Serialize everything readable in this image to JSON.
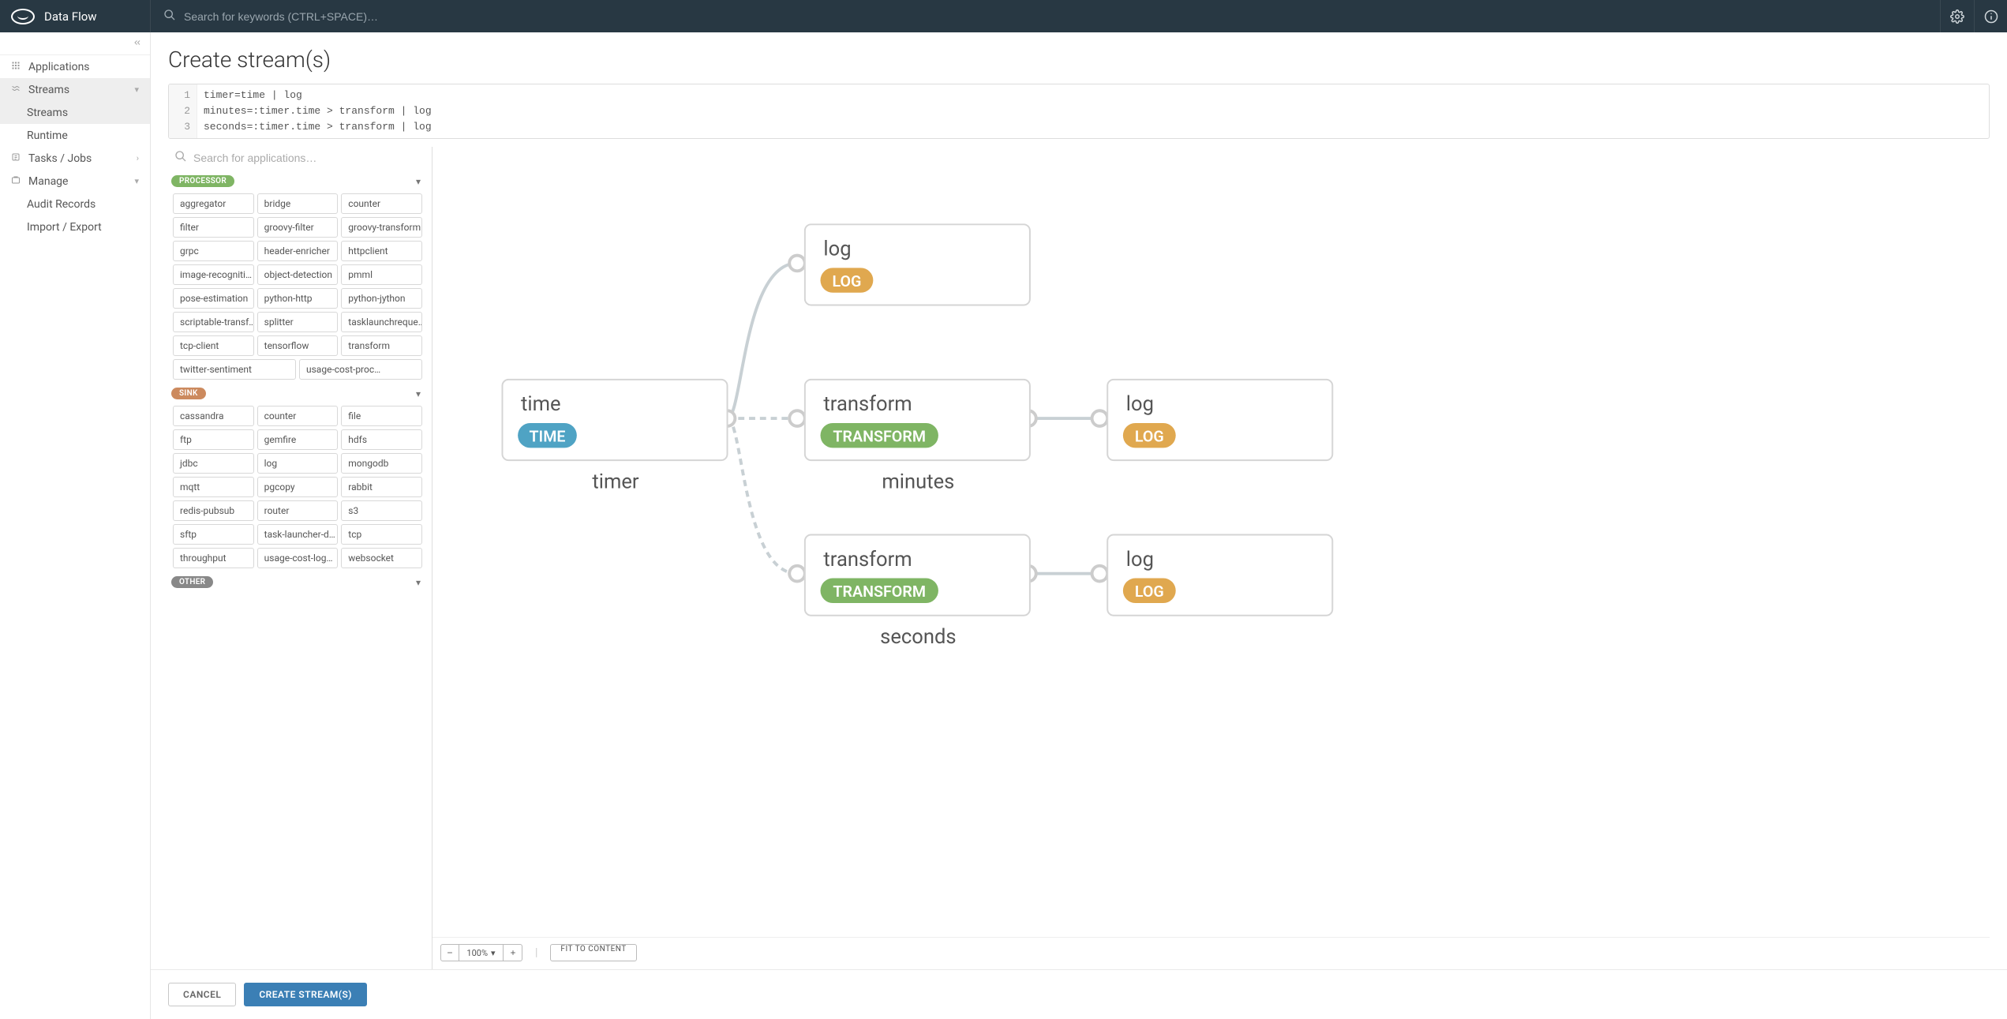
{
  "header": {
    "app_title": "Data Flow",
    "search_placeholder": "Search for keywords (CTRL+SPACE)…"
  },
  "sidebar": {
    "applications": "Applications",
    "streams": "Streams",
    "streams_children": [
      "Streams",
      "Runtime"
    ],
    "tasks": "Tasks / Jobs",
    "manage": "Manage",
    "manage_children": [
      "Audit Records",
      "Import / Export"
    ]
  },
  "page": {
    "title": "Create stream(s)"
  },
  "editor": {
    "lines": [
      "timer=time | log",
      "minutes=:timer.time > transform | log",
      "seconds=:timer.time > transform | log"
    ]
  },
  "palette": {
    "search_placeholder": "Search for applications…",
    "sections": [
      {
        "label": "PROCESSOR",
        "kind": "processor",
        "items": [
          "aggregator",
          "bridge",
          "counter",
          "filter",
          "groovy-filter",
          "groovy-transform",
          "grpc",
          "header-enricher",
          "httpclient",
          "image-recogniti…",
          "object-detection",
          "pmml",
          "pose-estimation",
          "python-http",
          "python-jython",
          "scriptable-transf…",
          "splitter",
          "tasklaunchreque…",
          "tcp-client",
          "tensorflow",
          "transform",
          "twitter-sentiment",
          "usage-cost-proc…"
        ]
      },
      {
        "label": "SINK",
        "kind": "sink",
        "items": [
          "cassandra",
          "counter",
          "file",
          "ftp",
          "gemfire",
          "hdfs",
          "jdbc",
          "log",
          "mongodb",
          "mqtt",
          "pgcopy",
          "rabbit",
          "redis-pubsub",
          "router",
          "s3",
          "sftp",
          "task-launcher-d…",
          "tcp",
          "throughput",
          "usage-cost-log…",
          "websocket"
        ]
      },
      {
        "label": "OTHER",
        "kind": "other",
        "items": []
      }
    ]
  },
  "canvas": {
    "zoom_label": "100%",
    "fit_label": "FIT TO CONTENT",
    "streams": [
      {
        "name": "",
        "nodes": [
          {
            "label": "log",
            "tag": "LOG",
            "tagColor": "#e0a84f"
          }
        ]
      },
      {
        "name": "timer",
        "source": {
          "label": "time",
          "tag": "TIME",
          "tagColor": "#4fa3c4"
        }
      },
      {
        "name": "minutes",
        "nodes": [
          {
            "label": "transform",
            "tag": "TRANSFORM",
            "tagColor": "#7fb564"
          },
          {
            "label": "log",
            "tag": "LOG",
            "tagColor": "#e0a84f"
          }
        ]
      },
      {
        "name": "seconds",
        "nodes": [
          {
            "label": "transform",
            "tag": "TRANSFORM",
            "tagColor": "#7fb564"
          },
          {
            "label": "log",
            "tag": "LOG",
            "tagColor": "#e0a84f"
          }
        ]
      }
    ]
  },
  "footer": {
    "cancel": "CANCEL",
    "create": "CREATE STREAM(S)"
  }
}
